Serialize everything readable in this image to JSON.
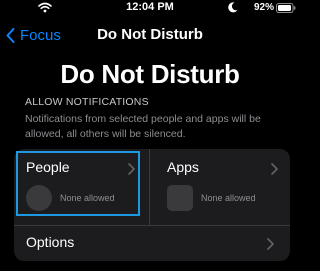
{
  "status": {
    "time": "12:04 PM",
    "battery_pct": "92%",
    "icons": [
      "wifi-icon",
      "moon-icon",
      "battery-icon"
    ]
  },
  "nav": {
    "back_label": "Focus",
    "title": "Do Not Disturb"
  },
  "large_title": "Do Not Disturb",
  "allow": {
    "header": "ALLOW NOTIFICATIONS",
    "description": "Notifications from selected people and apps will be allowed, all others will be silenced."
  },
  "cards": {
    "people": {
      "label": "People",
      "sub": "None allowed"
    },
    "apps": {
      "label": "Apps",
      "sub": "None allowed"
    },
    "options": {
      "label": "Options"
    }
  },
  "colors": {
    "accent": "#0a84ff",
    "highlight": "#1d98e3",
    "card": "#1c1c1e",
    "background": "#000000"
  }
}
